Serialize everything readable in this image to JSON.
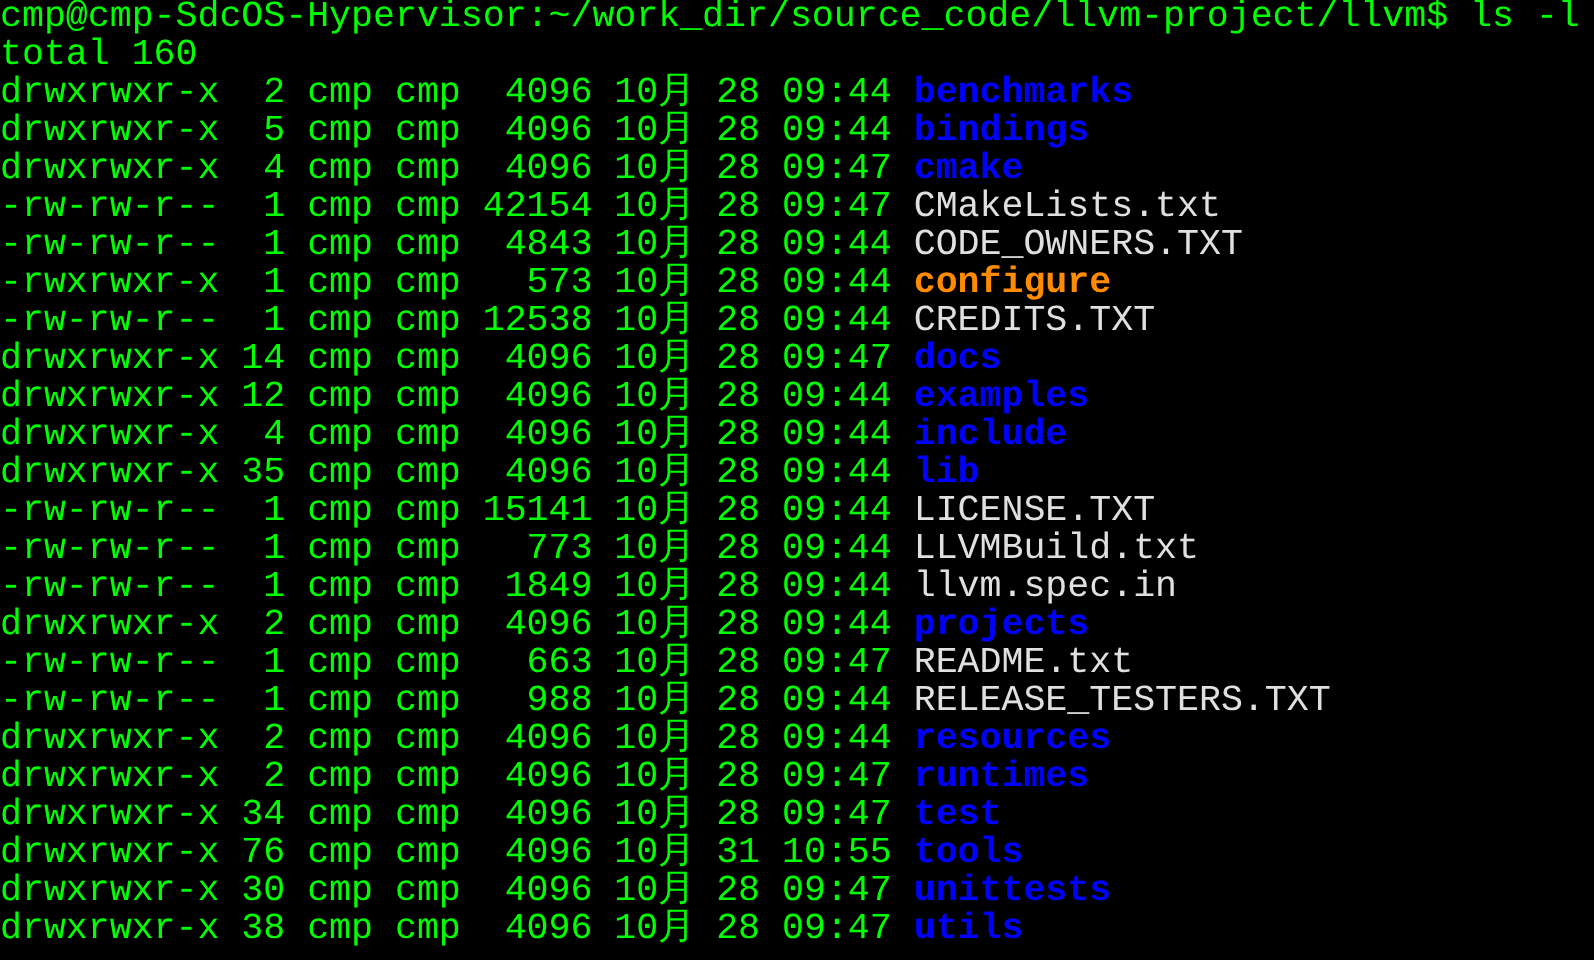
{
  "terminal": {
    "prompt": "cmp@cmp-SdcOS-Hypervisor:~/work_dir/source_code/llvm-project/llvm$ ls -l",
    "total": "total 160",
    "entries": [
      {
        "details": "drwxrwxr-x  2 cmp cmp  4096 10月 28 09:44",
        "name": "benchmarks",
        "kind": "directory"
      },
      {
        "details": "drwxrwxr-x  5 cmp cmp  4096 10月 28 09:44",
        "name": "bindings",
        "kind": "directory"
      },
      {
        "details": "drwxrwxr-x  4 cmp cmp  4096 10月 28 09:47",
        "name": "cmake",
        "kind": "directory"
      },
      {
        "details": "-rw-rw-r--  1 cmp cmp 42154 10月 28 09:47",
        "name": "CMakeLists.txt",
        "kind": "file"
      },
      {
        "details": "-rw-rw-r--  1 cmp cmp  4843 10月 28 09:44",
        "name": "CODE_OWNERS.TXT",
        "kind": "file"
      },
      {
        "details": "-rwxrwxr-x  1 cmp cmp   573 10月 28 09:44",
        "name": "configure",
        "kind": "executable"
      },
      {
        "details": "-rw-rw-r--  1 cmp cmp 12538 10月 28 09:44",
        "name": "CREDITS.TXT",
        "kind": "file"
      },
      {
        "details": "drwxrwxr-x 14 cmp cmp  4096 10月 28 09:47",
        "name": "docs",
        "kind": "directory"
      },
      {
        "details": "drwxrwxr-x 12 cmp cmp  4096 10月 28 09:44",
        "name": "examples",
        "kind": "directory"
      },
      {
        "details": "drwxrwxr-x  4 cmp cmp  4096 10月 28 09:44",
        "name": "include",
        "kind": "directory"
      },
      {
        "details": "drwxrwxr-x 35 cmp cmp  4096 10月 28 09:44",
        "name": "lib",
        "kind": "directory"
      },
      {
        "details": "-rw-rw-r--  1 cmp cmp 15141 10月 28 09:44",
        "name": "LICENSE.TXT",
        "kind": "file"
      },
      {
        "details": "-rw-rw-r--  1 cmp cmp   773 10月 28 09:44",
        "name": "LLVMBuild.txt",
        "kind": "file"
      },
      {
        "details": "-rw-rw-r--  1 cmp cmp  1849 10月 28 09:44",
        "name": "llvm.spec.in",
        "kind": "file"
      },
      {
        "details": "drwxrwxr-x  2 cmp cmp  4096 10月 28 09:44",
        "name": "projects",
        "kind": "directory"
      },
      {
        "details": "-rw-rw-r--  1 cmp cmp   663 10月 28 09:47",
        "name": "README.txt",
        "kind": "file"
      },
      {
        "details": "-rw-rw-r--  1 cmp cmp   988 10月 28 09:44",
        "name": "RELEASE_TESTERS.TXT",
        "kind": "file"
      },
      {
        "details": "drwxrwxr-x  2 cmp cmp  4096 10月 28 09:44",
        "name": "resources",
        "kind": "directory"
      },
      {
        "details": "drwxrwxr-x  2 cmp cmp  4096 10月 28 09:47",
        "name": "runtimes",
        "kind": "directory"
      },
      {
        "details": "drwxrwxr-x 34 cmp cmp  4096 10月 28 09:47",
        "name": "test",
        "kind": "directory"
      },
      {
        "details": "drwxrwxr-x 76 cmp cmp  4096 10月 31 10:55",
        "name": "tools",
        "kind": "directory"
      },
      {
        "details": "drwxrwxr-x 30 cmp cmp  4096 10月 28 09:47",
        "name": "unittests",
        "kind": "directory"
      },
      {
        "details": "drwxrwxr-x 38 cmp cmp  4096 10月 28 09:47",
        "name": "utils",
        "kind": "directory"
      }
    ]
  }
}
